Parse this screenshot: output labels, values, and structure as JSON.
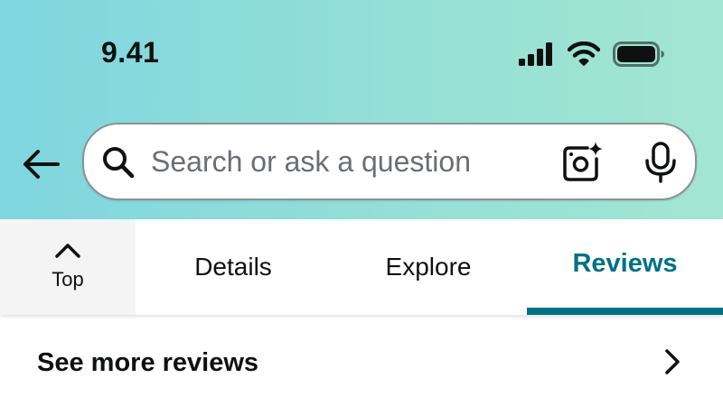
{
  "status_bar": {
    "time": "9.41",
    "icons": [
      "cellular-signal-icon",
      "wifi-icon",
      "battery-icon"
    ]
  },
  "header": {
    "back_icon": "back-arrow-icon",
    "search": {
      "placeholder": "Search or ask a question",
      "value": "",
      "icons": [
        "search-icon",
        "camera-sparkle-icon",
        "microphone-icon"
      ]
    }
  },
  "tabs": {
    "top_label": "Top",
    "top_icon": "chevron-up-icon",
    "items": [
      {
        "label": "Details",
        "active": false
      },
      {
        "label": "Explore",
        "active": false
      },
      {
        "label": "Reviews",
        "active": true
      }
    ]
  },
  "reviews_row": {
    "label": "See more reviews",
    "icon": "chevron-right-icon"
  },
  "colors": {
    "accent": "#007185",
    "header_gradient_start": "#7fd6df",
    "header_gradient_end": "#a3e6d2",
    "text": "#0f1111"
  }
}
